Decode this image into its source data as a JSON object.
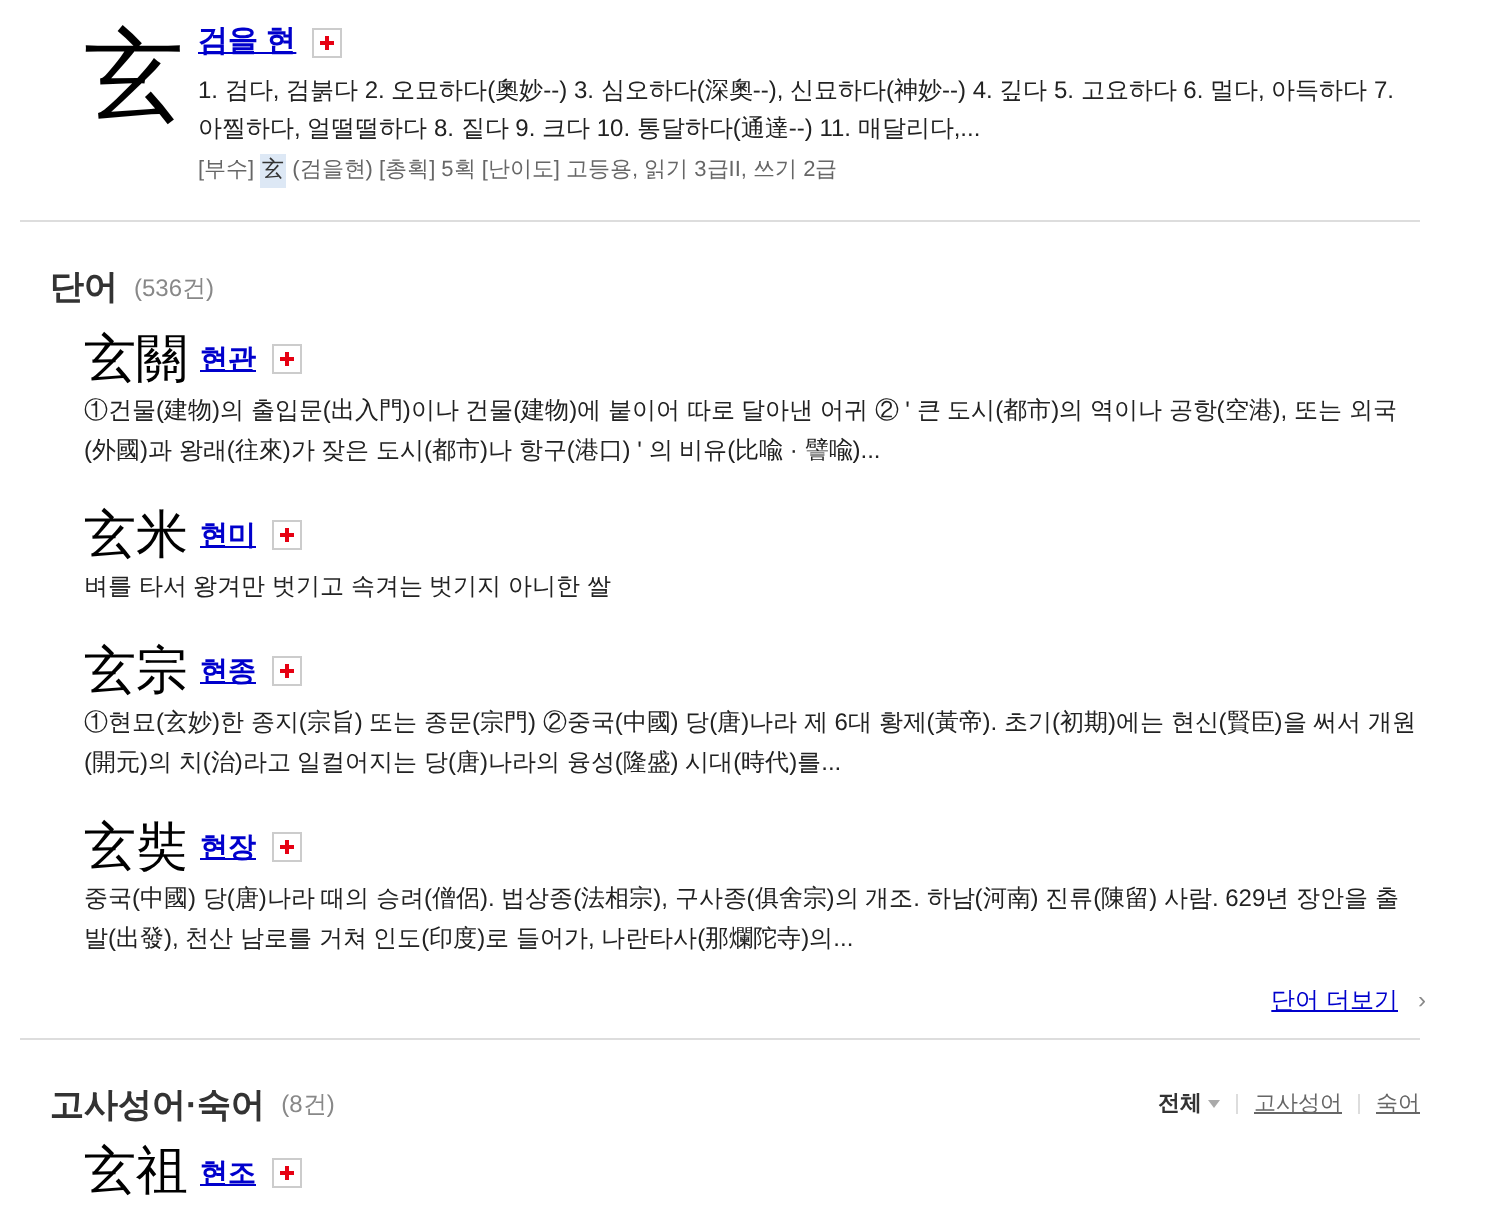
{
  "character": {
    "glyph": "玄",
    "reading": "검을 현",
    "definition": "1. 검다, 검붉다 2. 오묘하다(奧妙--) 3. 심오하다(深奧--), 신묘하다(神妙--) 4. 깊다 5. 고요하다 6. 멀다, 아득하다 7. 아찔하다, 얼떨떨하다 8. 짙다 9. 크다 10. 통달하다(通達--) 11. 매달리다,...",
    "meta_before": "[부수]",
    "radical": "玄",
    "meta_after": "(검을현) [총획] 5획 [난이도] 고등용, 읽기 3급II, 쓰기 2급"
  },
  "words": {
    "title": "단어",
    "count": "(536건)",
    "items": [
      {
        "hanja": "玄關",
        "reading": "현관",
        "definition": "①건물(建物)의 출입문(出入門)이나 건물(建物)에 붙이어 따로 달아낸 어귀 ② ' 큰 도시(都市)의 역이나 공항(空港), 또는 외국(外國)과 왕래(往來)가 잦은 도시(都市)나 항구(港口) ' 의 비유(比喩 · 譬喩)..."
      },
      {
        "hanja": "玄米",
        "reading": "현미",
        "definition": "벼를 타서 왕겨만 벗기고 속겨는 벗기지 아니한 쌀"
      },
      {
        "hanja": "玄宗",
        "reading": "현종",
        "definition": "①현묘(玄妙)한 종지(宗旨) 또는 종문(宗門) ②중국(中國) 당(唐)나라 제 6대 황제(黃帝). 초기(初期)에는 현신(賢臣)을 써서 개원(開元)의 치(治)라고 일컬어지는 당(唐)나라의 융성(隆盛) 시대(時代)를..."
      },
      {
        "hanja": "玄奘",
        "reading": "현장",
        "definition": "중국(中國) 당(唐)나라 때의 승려(僧侶). 법상종(法相宗), 구사종(俱舍宗)의 개조. 하남(河南) 진류(陳留) 사람. 629년 장안을 출발(出發), 천산 남로를 거쳐 인도(印度)로 들어가, 나란타사(那爛陀寺)의..."
      }
    ],
    "more": "단어 더보기",
    "more_arrow": "›"
  },
  "idioms": {
    "title": "고사성어·숙어",
    "count": "(8건)",
    "filters": [
      {
        "label": "전체",
        "selected": true
      },
      {
        "label": "고사성어",
        "selected": false
      },
      {
        "label": "숙어",
        "selected": false
      }
    ],
    "items": [
      {
        "hanja": "玄祖",
        "reading": "현조"
      }
    ]
  }
}
